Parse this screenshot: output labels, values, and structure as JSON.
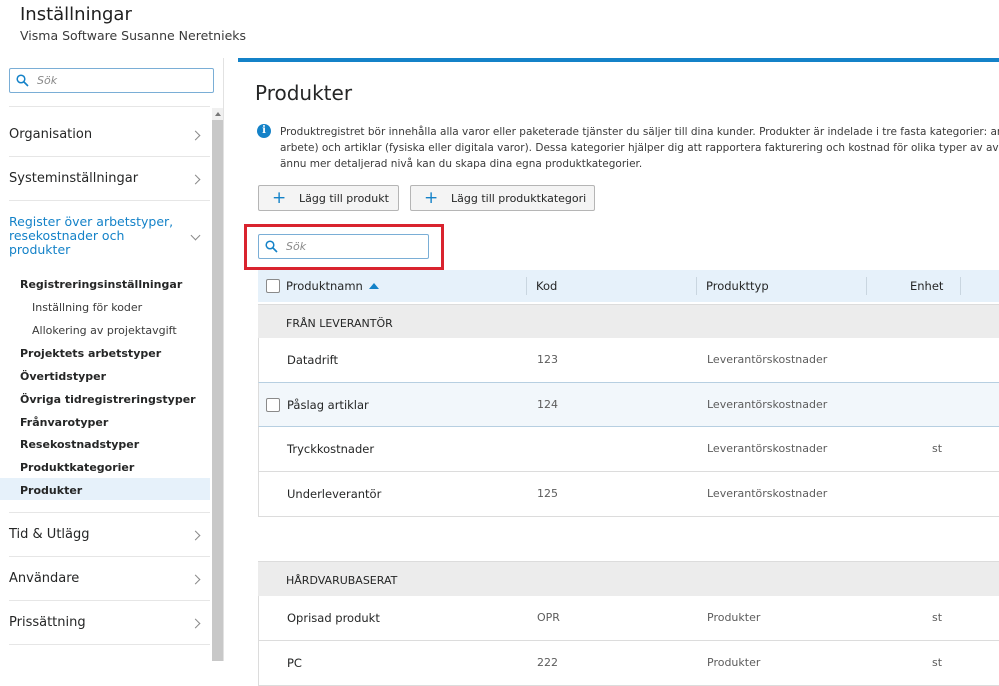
{
  "header": {
    "title": "Inställningar",
    "subtitle": "Visma Software Susanne Neretnieks"
  },
  "sidebar": {
    "search_placeholder": "Sök",
    "items": [
      {
        "label": "Organisation"
      },
      {
        "label": "Systeminställningar"
      },
      {
        "label_lines": [
          "Register över arbetstyper,",
          "resekostnader och",
          "produkter"
        ]
      },
      {
        "label": "Tid & Utlägg"
      },
      {
        "label": "Användare"
      },
      {
        "label": "Prissättning"
      }
    ],
    "sub_items": [
      "Registreringsinställningar",
      "Inställning för koder",
      "Allokering av projektavgift",
      "Projektets arbetstyper",
      "Övertidstyper",
      "Övriga tidregistreringstyper",
      "Frånvarotyper",
      "Resekostnadstyper",
      "Produktkategorier",
      "Produkter"
    ]
  },
  "main": {
    "title": "Produkter",
    "info_lines": [
      "Produktregistret bör innehålla alla varor eller paketerade tjänster du säljer till dina kunder. Produkter är indelade i tre fasta kategorier: arv",
      "arbete) och artiklar (fysiska eller digitala varor). Dessa kategorier hjälper dig att rapportera fakturering och kostnad för olika typer av avgift",
      "ännu mer detaljerad nivå kan du skapa dina egna produktkategorier."
    ],
    "add_product_label": "Lägg till produkt",
    "add_category_label": "Lägg till produktkategori",
    "search_placeholder": "Sök",
    "columns": [
      "Produktnamn",
      "Kod",
      "Produkttyp",
      "Enhet"
    ],
    "groups": [
      {
        "name": "FRÅN LEVERANTÖR",
        "rows": [
          {
            "name": "Datadrift",
            "code": "123",
            "type": "Leverantörskostnader",
            "unit": ""
          },
          {
            "name": "Påslag artiklar",
            "code": "124",
            "type": "Leverantörskostnader",
            "unit": ""
          },
          {
            "name": "Tryckkostnader",
            "code": "",
            "type": "Leverantörskostnader",
            "unit": "st"
          },
          {
            "name": "Underleverantör",
            "code": "125",
            "type": "Leverantörskostnader",
            "unit": ""
          }
        ]
      },
      {
        "name": "HÅRDVARUBASERAT",
        "rows": [
          {
            "name": "Oprisad produkt",
            "code": "OPR",
            "type": "Produkter",
            "unit": "st"
          },
          {
            "name": "PC",
            "code": "222",
            "type": "Produkter",
            "unit": "st"
          }
        ]
      }
    ]
  },
  "colors": {
    "accent": "#1482c8",
    "highlight_box": "#d9232e",
    "header_row_bg": "#e6f1fa"
  }
}
